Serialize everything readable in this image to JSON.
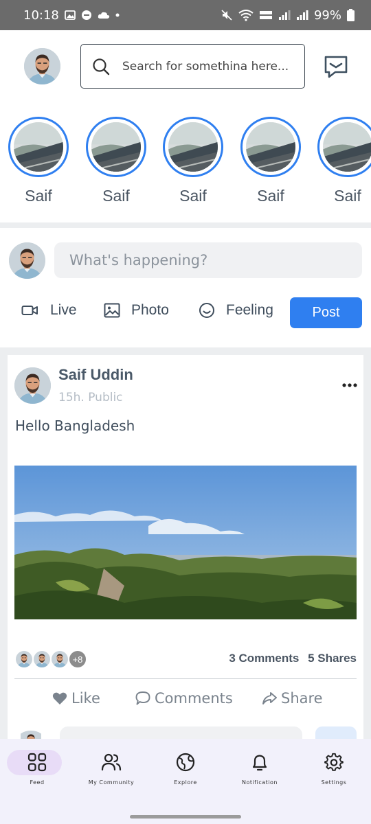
{
  "status_bar": {
    "time": "10:18",
    "battery": "99%"
  },
  "search": {
    "placeholder": "Search for somethina here..."
  },
  "stories": [
    {
      "name": "Saif"
    },
    {
      "name": "Saif"
    },
    {
      "name": "Saif"
    },
    {
      "name": "Saif"
    },
    {
      "name": "Saif"
    }
  ],
  "composer": {
    "placeholder": "What's happening?",
    "live_label": "Live",
    "photo_label": "Photo",
    "feeling_label": "Feeling",
    "post_label": "Post"
  },
  "post": {
    "author": "Saif Uddin",
    "meta": "15h. Public",
    "text": "Hello Bangladesh",
    "extra_reactors": "+8",
    "comments_count": "3 Comments",
    "shares_count": "5 Shares",
    "like_label": "Like",
    "comments_label": "Comments",
    "share_label": "Share"
  },
  "bottom_nav": {
    "feed": "Feed",
    "community": "My Community",
    "explore": "Explore",
    "notification": "Notification",
    "settings": "Settings"
  },
  "colors": {
    "accent": "#2f7ff0",
    "nav_bg": "#f2f1fb",
    "nav_active": "#e8dcf7"
  }
}
